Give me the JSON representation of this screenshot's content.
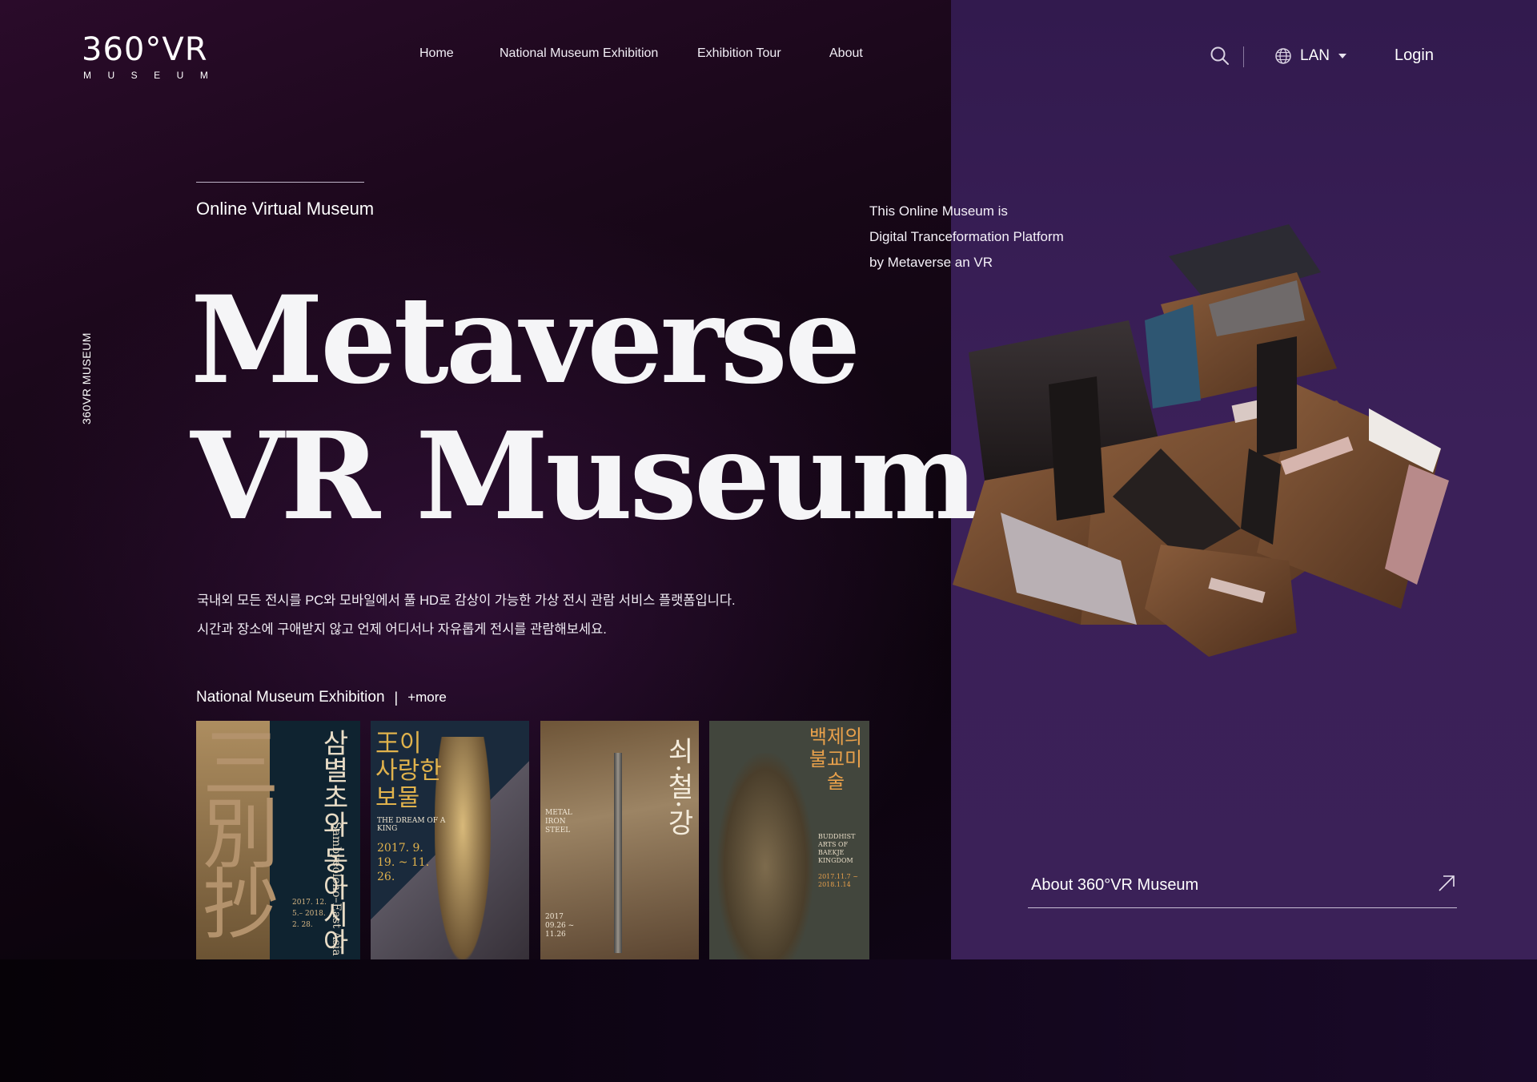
{
  "header": {
    "logo_main": "360°VR",
    "logo_sub": "MUSEUM",
    "nav": [
      "Home",
      "National Museum Exhibition",
      "Exhibition Tour",
      "About"
    ],
    "lang_label": "LAN",
    "login_label": "Login"
  },
  "side_label": "360VR MUSEUM",
  "hero": {
    "eyebrow": "Online Virtual Museum",
    "title_line1": "Metaverse",
    "title_line2": "VR Museum",
    "desc_line1": "국내외 모든 전시를 PC와 모바일에서 풀 HD로 감상이 가능한 가상 전시 관람 서비스 플랫폼입니다.",
    "desc_line2": "시간과 장소에 구애받지 않고 언제 어디서나 자유롭게 전시를 관람해보세요."
  },
  "intro": {
    "line1": "This Online Museum is",
    "line2": "Digital Tranceformation Platform",
    "line3": "by Metaverse an VR"
  },
  "exhibitions": {
    "title": "National Museum Exhibition",
    "separator": "|",
    "more": "+more",
    "posters": [
      {
        "title": "삼별초와 동아시아",
        "subtitle": "Sambyeolcho–East Asia",
        "dates": "2017. 12. 5.– 2018. 2. 28."
      },
      {
        "title": "王이 사랑한 보물",
        "subtitle": "THE DREAM OF A KING",
        "dates": "2017. 9. 19. ~ 11. 26."
      },
      {
        "title": "쇠·철·강",
        "subtitle": "METAL IRON STEEL",
        "dates": "2017 09.26 ~ 11.26"
      },
      {
        "title": "백제의 불교미술",
        "subtitle": "BUDDHIST ARTS OF BAEKJE KINGDOM",
        "dates": "2017.11.7 ~ 2018.1.14"
      }
    ]
  },
  "about_link": "About 360°VR Museum",
  "colors": {
    "accent_panel": "#3b2059",
    "background": "#14071a"
  }
}
